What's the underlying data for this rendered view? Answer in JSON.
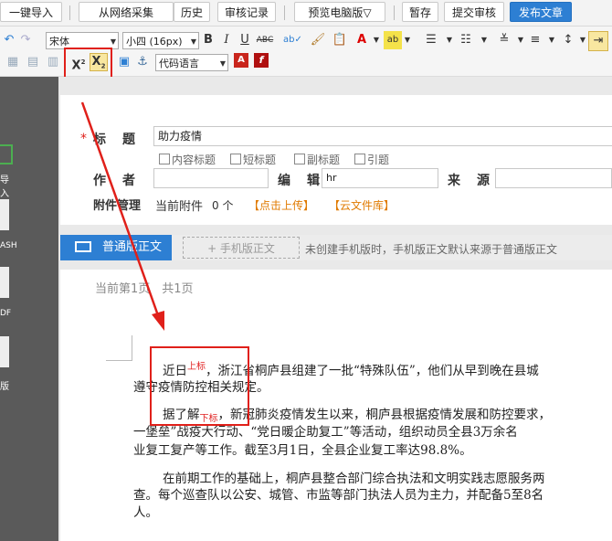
{
  "topbar": {
    "buttons": [
      "一键导入",
      "从网络采集",
      "历史",
      "审核记录",
      "预览电脑版▽",
      "暂存",
      "提交审核",
      "发布文章"
    ]
  },
  "toolbar": {
    "font_name": "宋体",
    "font_size": "小四 (16px)",
    "code_lang": "代码语言",
    "icons": [
      "undo-icon",
      "redo-icon",
      "bold-icon",
      "italic-icon",
      "underline-icon",
      "strikethrough-icon",
      "spellcheck-icon",
      "format-painter-icon",
      "paste-icon",
      "font-color-icon",
      "highlight-icon",
      "ordered-list-icon",
      "unordered-list-icon",
      "line-height-icon",
      "paragraph-spacing-icon",
      "indent-icon",
      "superscript-icon",
      "subscript-icon",
      "image-icon",
      "anchor-icon",
      "pdf-icon",
      "flash-icon"
    ]
  },
  "leftstrip": {
    "labels": [
      "导入",
      "ASH",
      "DF",
      "版"
    ]
  },
  "form": {
    "required_mark": "*",
    "title_label": "标　题",
    "title_value": "助力疫情",
    "checkboxes": [
      "内容标题",
      "短标题",
      "副标题",
      "引题"
    ],
    "author_label": "作　者",
    "editor_label": "编　辑",
    "editor_value": "hr",
    "source_label": "来　源",
    "attach_label": "附件管理",
    "attach_current": "当前附件",
    "attach_count": "0 个",
    "upload_link": "【点击上传】",
    "cloud_link": "【云文件库】"
  },
  "modebar": {
    "normal_tab": "普通版正文",
    "mobile_tab": "+ 手机版正文",
    "hint": "未创建手机版时，手机版正文默认来源于普通版正文"
  },
  "doc": {
    "page_info": "当前第1页　共1页",
    "p1_a": "近日",
    "p1_sup": "上标",
    "p1_b": "，浙江省桐庐县组建了一批“特殊队伍”，他们从早到晚在县城",
    "p1_c": "遵守疫情防控相关规定。",
    "p2_a": "据了解",
    "p2_sub": "下标",
    "p2_b": "，新冠肺炎疫情发生以来，桐庐县根据疫情发展和防控要求，",
    "p2_c": "一堡垒”战疫大行动、“党日暖企助复工”等活动，组织动员全县3万余名",
    "p2_d": "业复工复产等工作。截至3月1日，全县企业复工率达98.8%。",
    "p3_a": "在前期工作的基础上，桐庐县整合部门综合执法和文明实践志愿服务两",
    "p3_b": "查。每个巡查队以公安、城管、市监等部门执法人员为主力，并配备5至8名",
    "p3_c": "人。"
  },
  "colors": {
    "accent": "#2d7fd3",
    "annotation": "#e0201a",
    "link": "#e07a00"
  }
}
